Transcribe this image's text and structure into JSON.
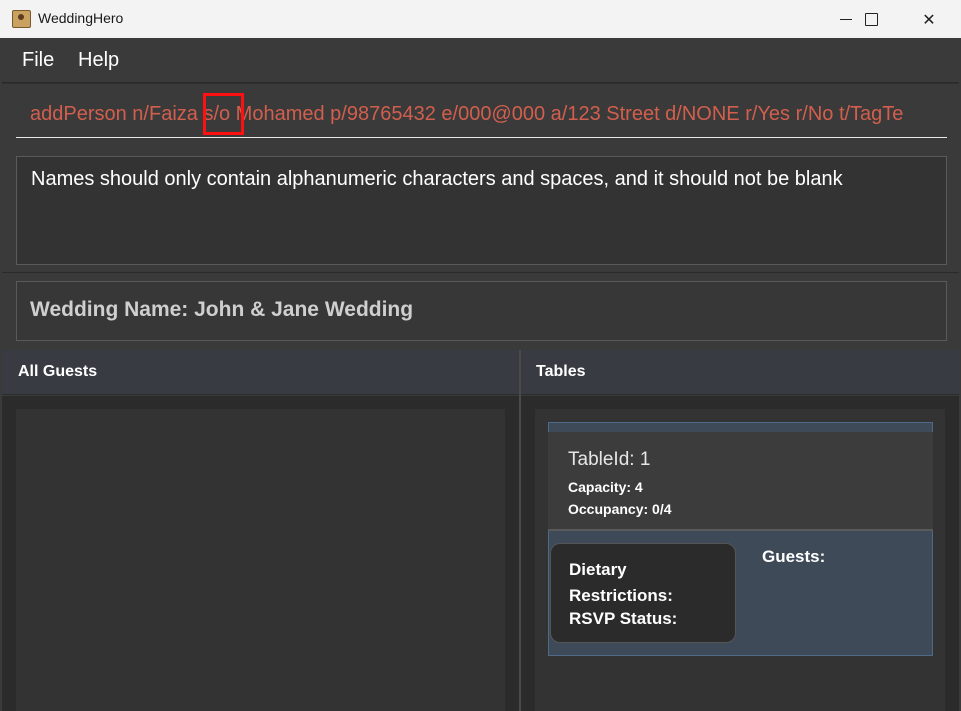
{
  "window": {
    "title": "WeddingHero",
    "controls": {
      "minimize": "minimize-icon",
      "maximize": "maximize-icon",
      "close": "✕"
    }
  },
  "menu": {
    "file": "File",
    "help": "Help"
  },
  "command": {
    "value": "addPerson n/Faiza s/o Mohamed p/98765432 e/000@000 a/123 Street d/NONE r/Yes r/No t/TagTe",
    "text_color": "#d25f4d",
    "highlight_color": "#ff1010"
  },
  "result": {
    "message": "Names should only contain alphanumeric characters and spaces, and it should not be blank"
  },
  "wedding": {
    "label": "Wedding Name: John & Jane Wedding"
  },
  "panels": {
    "guests_title": "All Guests",
    "tables_title": "Tables"
  },
  "tables": [
    {
      "table_id": "TableId: 1",
      "capacity": "Capacity: 4",
      "occupancy": "Occupancy: 0/4",
      "dietary": "Dietary Restrictions:",
      "rsvp": "RSVP Status:",
      "guests": "Guests:"
    }
  ]
}
